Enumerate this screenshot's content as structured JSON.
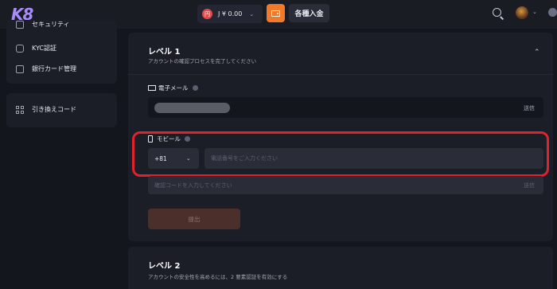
{
  "header": {
    "logo": "K8",
    "currency_badge": "円",
    "balance": "J ¥ 0.00",
    "deposit_label": "各種入金"
  },
  "sidebar": {
    "items": [
      {
        "label": "セキュリティ"
      },
      {
        "label": "KYC認証"
      },
      {
        "label": "銀行カード管理"
      }
    ],
    "redeem_label": "引き換えコード"
  },
  "level1": {
    "title": "レベル 1",
    "subtitle": "アカウントの確認プロセスを完了してください",
    "email": {
      "label": "電子メール",
      "send_label": "送信"
    },
    "mobile": {
      "label": "モビール",
      "country_code": "+81",
      "phone_placeholder": "電話番号をご入力ください",
      "code_placeholder": "確認コードを入力してください",
      "send_label": "送信",
      "submit_label": "提出"
    }
  },
  "level2": {
    "title": "レベル 2",
    "subtitle": "アカウントの安全性を高めるには、2 要素認証を有効にする"
  },
  "colors": {
    "accent": "#f07a2a",
    "highlight": "#e0222c",
    "logo": "#a78bfa"
  }
}
